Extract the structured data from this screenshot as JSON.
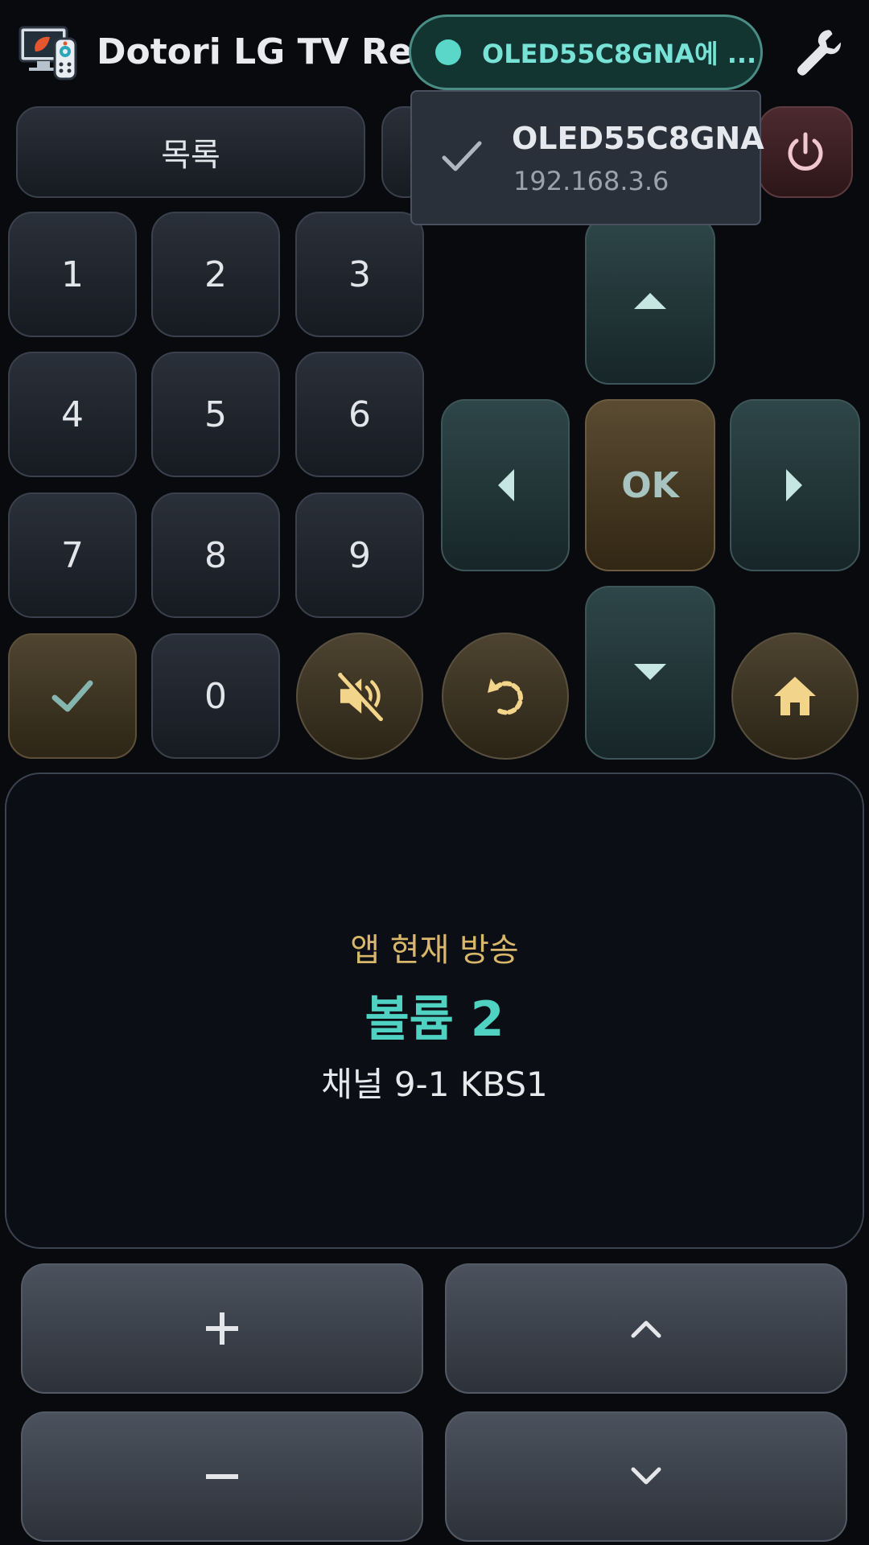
{
  "header": {
    "app_title": "Dotori LG TV Re...",
    "device_chip_label": "OLED55C8GNA에 ..."
  },
  "top_row": {
    "list_label": "목록"
  },
  "numpad": {
    "keys": [
      "1",
      "2",
      "3",
      "4",
      "5",
      "6",
      "7",
      "8",
      "9"
    ],
    "zero": "0"
  },
  "dpad": {
    "ok_label": "OK"
  },
  "status": {
    "app_line": "앱 현재 방송",
    "volume_line": "볼륨 2",
    "channel_line": "채널 9-1 KBS1"
  },
  "dropdown": {
    "device_name": "OLED55C8GNA",
    "device_ip": "192.168.3.6"
  },
  "colors": {
    "background": "#080a0e",
    "accent_teal": "#4fd2c2",
    "accent_gold": "#d8b76b",
    "power_red": "#f0c7cc"
  },
  "icons": {
    "app_logo": "tv-remote-logo-icon",
    "settings": "wrench-icon",
    "power": "power-icon",
    "check": "check-icon",
    "mute": "mute-icon",
    "back": "back-arrow-icon",
    "home": "home-icon"
  }
}
